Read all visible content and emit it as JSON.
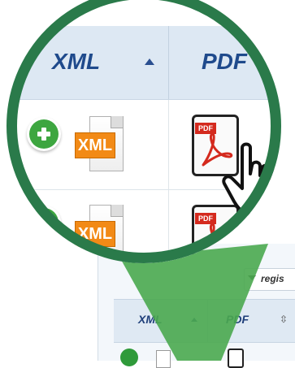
{
  "background_table": {
    "entries_control_text": "regis",
    "header": {
      "xml": "XML",
      "pdf": "PDF",
      "xml_sort": "ascending",
      "pdf_sort_glyph": "⇳"
    }
  },
  "zoom": {
    "header": {
      "xml": "XML",
      "pdf": "PDF",
      "xml_sort": "ascending"
    },
    "rows": [
      {
        "add_icon": "add-circle-icon",
        "xml_tag": "XML",
        "pdf_tag": "PDF"
      },
      {
        "add_icon": "add-circle-icon",
        "xml_tag": "XML",
        "pdf_tag": "PDF"
      }
    ]
  },
  "colors": {
    "ring": "#2a7a4a",
    "header_bg": "#dde8f3",
    "header_text": "#1f4a8c",
    "add_green": "#3da640",
    "xml_orange": "#f28a16",
    "pdf_red": "#d42a1e"
  },
  "icons": [
    "add-circle-icon",
    "xml-file-icon",
    "pdf-file-icon",
    "hand-pointer-icon",
    "sort-ascending-icon",
    "sort-both-icon",
    "dropdown-arrow-icon"
  ]
}
